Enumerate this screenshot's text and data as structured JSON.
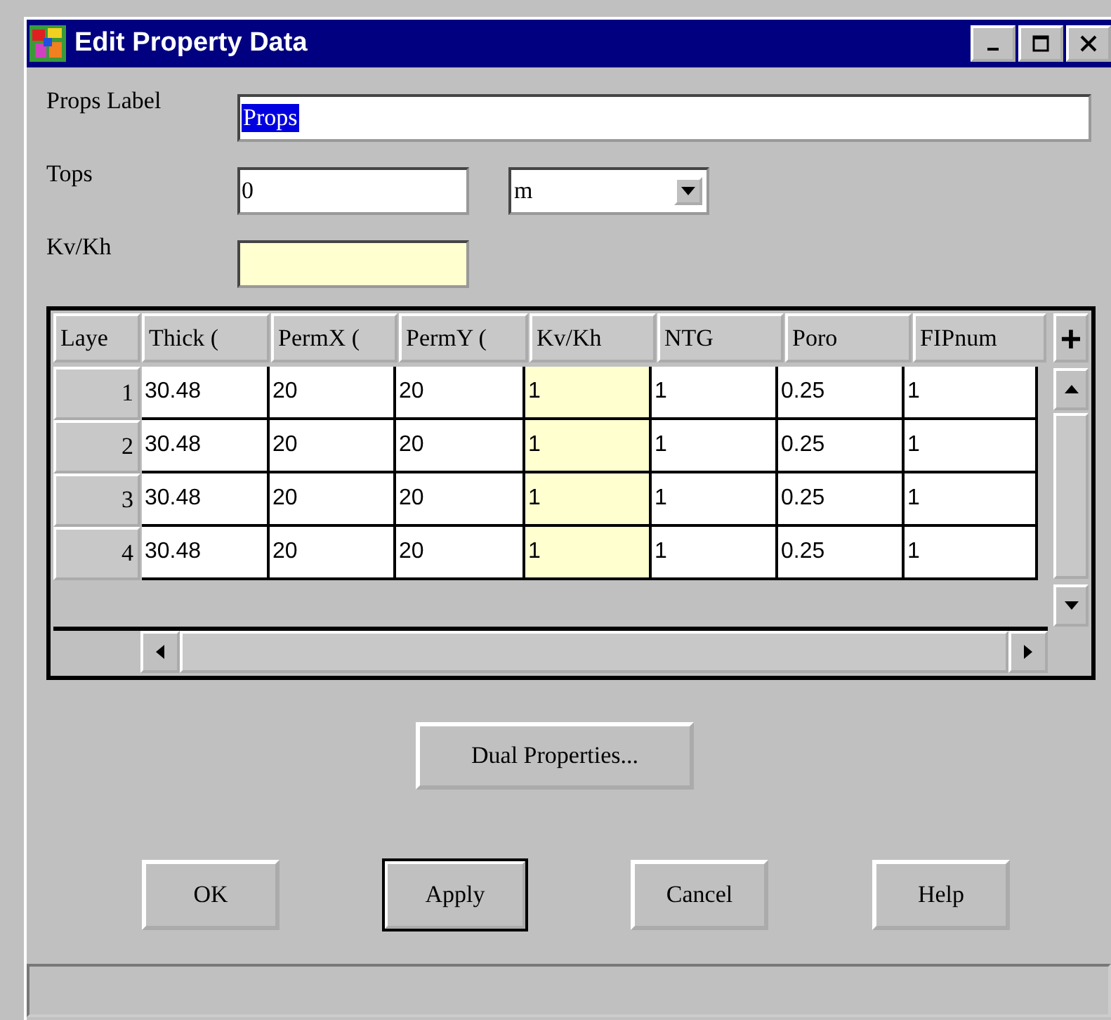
{
  "window": {
    "title": "Edit Property Data"
  },
  "props_label": {
    "label": "Props Label",
    "value": "Props",
    "text_selected": true
  },
  "tops": {
    "label": "Tops",
    "value": "0",
    "unit": "m"
  },
  "kv_kh": {
    "label": "Kv/Kh",
    "highlighted": true
  },
  "table": {
    "columns": [
      {
        "label": "Laye",
        "highlighted": false
      },
      {
        "label": "Thick (",
        "highlighted": false
      },
      {
        "label": "PermX (",
        "highlighted": false
      },
      {
        "label": "PermY (",
        "highlighted": false
      },
      {
        "label": "Kv/Kh",
        "highlighted": true
      },
      {
        "label": "NTG",
        "highlighted": false
      },
      {
        "label": "Poro",
        "highlighted": false
      },
      {
        "label": "FIPnum",
        "highlighted": false
      }
    ],
    "add_button": "+",
    "rows": [
      {
        "cells": [
          "1",
          "30.48",
          "20",
          "20",
          "1",
          "1",
          "0.25",
          "1"
        ]
      },
      {
        "cells": [
          "2",
          "30.48",
          "20",
          "20",
          "1",
          "1",
          "0.25",
          "1"
        ]
      },
      {
        "cells": [
          "3",
          "30.48",
          "20",
          "20",
          "1",
          "1",
          "0.25",
          "1"
        ]
      },
      {
        "cells": [
          "4",
          "30.48",
          "20",
          "20",
          "1",
          "1",
          "0.25",
          "1"
        ]
      }
    ]
  },
  "dual_button": "Dual Properties...",
  "buttons": [
    {
      "label": "OK",
      "default": false
    },
    {
      "label": "Apply",
      "default": true
    },
    {
      "label": "Cancel",
      "default": false
    },
    {
      "label": "Help",
      "default": false
    }
  ]
}
